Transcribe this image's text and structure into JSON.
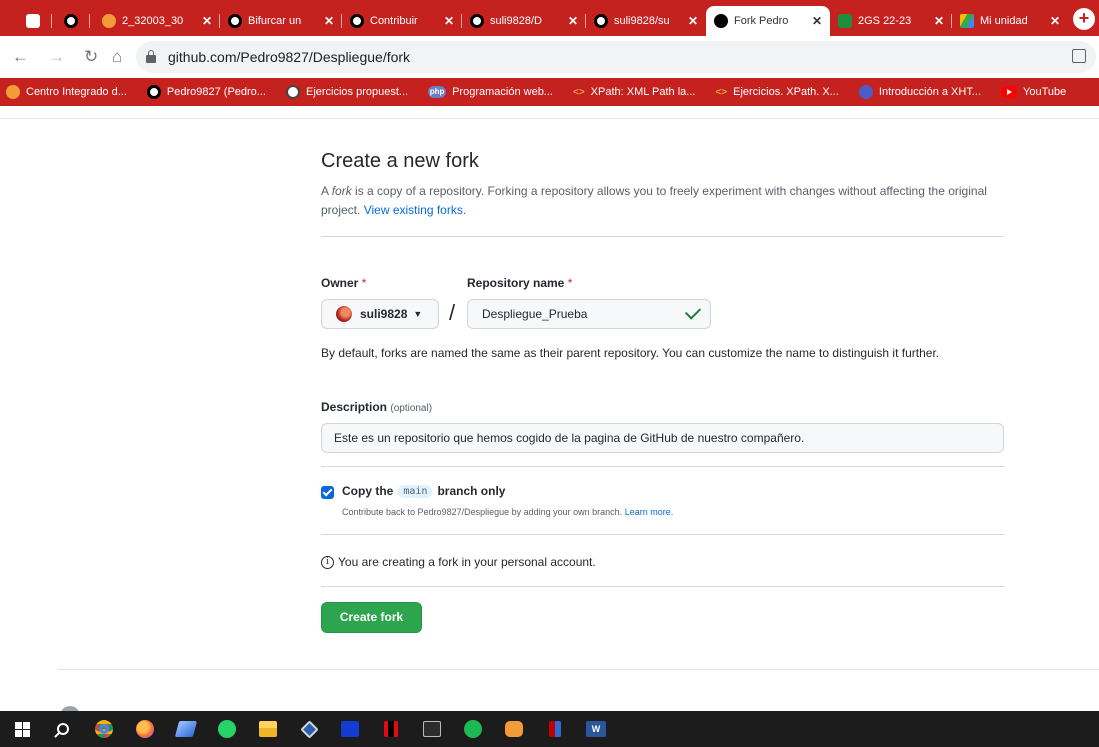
{
  "browser": {
    "tabs": [
      {
        "title": "",
        "icon": "app-icon",
        "closable": false
      },
      {
        "title": "",
        "icon": "github-icon",
        "closable": false
      },
      {
        "title": "2_32003_30",
        "icon": "moodle-icon",
        "closable": true
      },
      {
        "title": "Bifurcar un",
        "icon": "github-icon",
        "closable": true
      },
      {
        "title": "Contribuir",
        "icon": "github-icon",
        "closable": true
      },
      {
        "title": "suli9828/D",
        "icon": "github-icon",
        "closable": true
      },
      {
        "title": "suli9828/su",
        "icon": "github-icon",
        "closable": true
      },
      {
        "title": "Fork Pedro",
        "icon": "github-icon",
        "closable": true,
        "active": true
      },
      {
        "title": "2GS 22-23",
        "icon": "classroom-icon",
        "closable": true
      },
      {
        "title": "Mi unidad",
        "icon": "drive-icon",
        "closable": true
      }
    ],
    "url": "github.com/Pedro9827/Despliegue/fork",
    "bookmarks": [
      {
        "label": "Centro Integrado d...",
        "icon": "moodle-icon"
      },
      {
        "label": "Pedro9827 (Pedro...",
        "icon": "github-icon"
      },
      {
        "label": "Ejercicios propuest...",
        "icon": "web-icon"
      },
      {
        "label": "Programación web...",
        "icon": "php-icon",
        "badge": "php"
      },
      {
        "label": "XPath: XML Path la...",
        "icon": "code-icon",
        "badge": "<>"
      },
      {
        "label": "Ejercicios. XPath. X...",
        "icon": "code-icon",
        "badge": "<>"
      },
      {
        "label": "Introducción a XHT...",
        "icon": "globe-icon"
      },
      {
        "label": "YouTube",
        "icon": "youtube-icon"
      }
    ],
    "colors": {
      "chrome_accent": "#c5221f",
      "link": "#0969da",
      "primary_button": "#2da44e"
    }
  },
  "fork": {
    "title": "Create a new fork",
    "lead_prefix": "A ",
    "lead_em": "fork",
    "lead_body": " is a copy of a repository. Forking a repository allows you to freely experiment with changes without affecting the original project.",
    "lead_link": "View existing forks.",
    "owner_label": "Owner",
    "repo_label": "Repository name",
    "required_mark": "*",
    "owner_value": "suli9828",
    "separator": "/",
    "repo_value": "Despliegue_Prueba",
    "name_help": "By default, forks are named the same as their parent repository. You can customize the name to distinguish it further.",
    "description_label": "Description",
    "description_optional": "(optional)",
    "description_value": "Este es un repositorio que hemos cogido de la pagina de GitHub de nuestro compañero.",
    "copy_checked": true,
    "copy_pre": "Copy the",
    "copy_branch": "main",
    "copy_post": "branch only",
    "copy_help": "Contribute back to Pedro9827/Despliegue by adding your own branch.",
    "copy_learn_more": "Learn more.",
    "info_text": "You are creating a fork in your personal account.",
    "create_button": "Create fork"
  },
  "taskbar": {
    "icons": [
      "windows-start-icon",
      "search-icon",
      "chrome-icon",
      "firefox-icon",
      "notes-icon",
      "whatsapp-icon",
      "file-explorer-icon",
      "virtualbox-icon",
      "disney-plus-icon",
      "netflix-icon",
      "terminal-icon",
      "spotify-icon",
      "app-icon",
      "filezilla-icon",
      "word-icon"
    ]
  }
}
